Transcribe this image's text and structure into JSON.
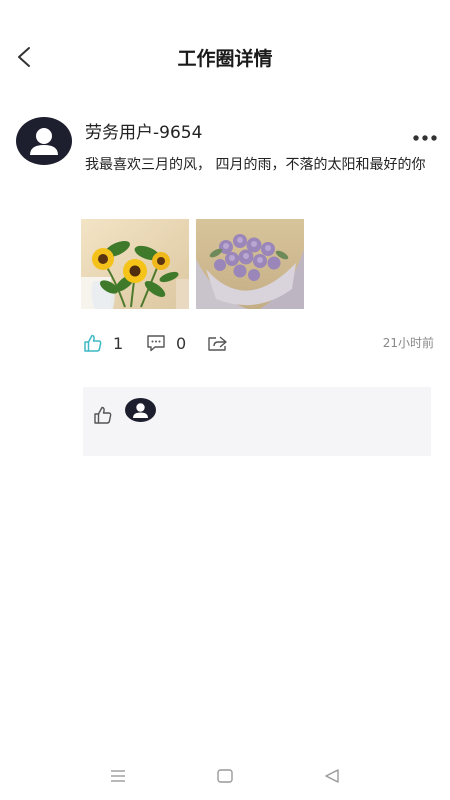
{
  "header": {
    "title": "工作圈详情",
    "back_icon": "chevron-left-icon"
  },
  "post": {
    "author": "劳务用户-9654",
    "text": "我最喜欢三月的风， 四月的雨，不落的太阳和最好的你",
    "images": [
      {
        "name": "sunflowers-photo",
        "subject": "sunflowers"
      },
      {
        "name": "purple-roses-photo",
        "subject": "purple roses bouquet"
      }
    ],
    "like_count": "1",
    "comment_count": "0",
    "time": "21小时前",
    "like_icon": "thumbs-up-icon",
    "comment_icon": "comment-icon",
    "share_icon": "share-icon",
    "more_icon": "more-dots-icon"
  },
  "likes_panel": {
    "icon": "thumbs-up-icon",
    "likers": [
      "default-avatar"
    ]
  },
  "nav_bar": {
    "icons": [
      "menu-icon",
      "home-square-icon",
      "back-triangle-icon"
    ]
  },
  "colors": {
    "like_accent": "#3fb8c4",
    "avatar_bg": "#1d1f2e",
    "panel_bg": "#f5f4f6",
    "muted_text": "#888888"
  }
}
